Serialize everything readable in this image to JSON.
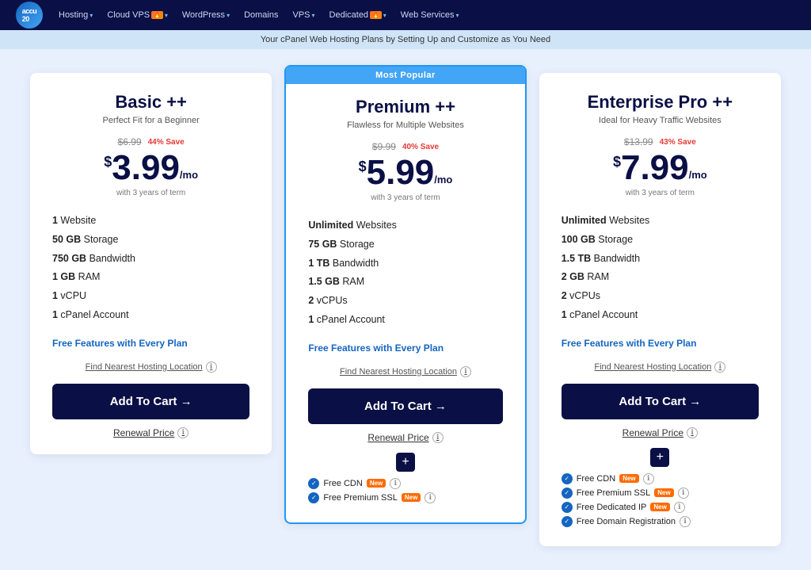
{
  "navbar": {
    "logo_text": "accu20",
    "items": [
      {
        "label": "Hosting",
        "has_chevron": true,
        "badge": null
      },
      {
        "label": "Cloud VPS",
        "has_chevron": true,
        "badge": "🔥"
      },
      {
        "label": "WordPress",
        "has_chevron": true,
        "badge": null
      },
      {
        "label": "Domains",
        "has_chevron": false,
        "badge": null
      },
      {
        "label": "VPS",
        "has_chevron": true,
        "badge": null
      },
      {
        "label": "Dedicated",
        "has_chevron": true,
        "badge": "🔥"
      },
      {
        "label": "Web Services",
        "has_chevron": true,
        "badge": null
      }
    ]
  },
  "subtitle": "Your cPanel Web Hosting Plans by Setting Up and Customize as You Need",
  "plans": [
    {
      "id": "basic",
      "name": "Basic ++",
      "tagline": "Perfect Fit for a Beginner",
      "popular": false,
      "original_price": "$6.99",
      "save_text": "44% Save",
      "price": "3.99",
      "price_term": "with 3 years of term",
      "features": [
        {
          "bold": "1",
          "text": " Website"
        },
        {
          "bold": "50 GB",
          "text": " Storage"
        },
        {
          "bold": "750 GB",
          "text": " Bandwidth"
        },
        {
          "bold": "1 GB",
          "text": " RAM"
        },
        {
          "bold": "1",
          "text": " vCPU"
        },
        {
          "bold": "1",
          "text": " cPanel Account"
        }
      ],
      "free_features_label": "Free Features with Every Plan",
      "hosting_location_label": "Find Nearest Hosting Location",
      "add_to_cart_label": "Add To Cart →",
      "renewal_label": "Renewal Price",
      "expand": false,
      "bonus_features": []
    },
    {
      "id": "premium",
      "name": "Premium ++",
      "tagline": "Flawless for Multiple Websites",
      "popular": true,
      "popular_label": "Most Popular",
      "original_price": "$9.99",
      "save_text": "40% Save",
      "price": "5.99",
      "price_term": "with 3 years of term",
      "features": [
        {
          "bold": "Unlimited",
          "text": " Websites"
        },
        {
          "bold": "75 GB",
          "text": " Storage"
        },
        {
          "bold": "1 TB",
          "text": " Bandwidth"
        },
        {
          "bold": "1.5 GB",
          "text": " RAM"
        },
        {
          "bold": "2",
          "text": " vCPUs"
        },
        {
          "bold": "1",
          "text": " cPanel Account"
        }
      ],
      "free_features_label": "Free Features with Every Plan",
      "hosting_location_label": "Find Nearest Hosting Location",
      "add_to_cart_label": "Add To Cart →",
      "renewal_label": "Renewal Price",
      "expand": true,
      "bonus_features": [
        {
          "label": "Free CDN",
          "badge": "New"
        },
        {
          "label": "Free Premium SSL",
          "badge": "New"
        }
      ]
    },
    {
      "id": "enterprise",
      "name": "Enterprise Pro ++",
      "tagline": "Ideal for Heavy Traffic Websites",
      "popular": false,
      "original_price": "$13.99",
      "save_text": "43% Save",
      "price": "7.99",
      "price_term": "with 3 years of term",
      "features": [
        {
          "bold": "Unlimited",
          "text": " Websites"
        },
        {
          "bold": "100 GB",
          "text": " Storage"
        },
        {
          "bold": "1.5 TB",
          "text": " Bandwidth"
        },
        {
          "bold": "2 GB",
          "text": " RAM"
        },
        {
          "bold": "2",
          "text": " vCPUs"
        },
        {
          "bold": "1",
          "text": " cPanel Account"
        }
      ],
      "free_features_label": "Free Features with Every Plan",
      "hosting_location_label": "Find Nearest Hosting Location",
      "add_to_cart_label": "Add To Cart →",
      "renewal_label": "Renewal Price",
      "expand": true,
      "bonus_features": [
        {
          "label": "Free CDN",
          "badge": "New"
        },
        {
          "label": "Free Premium SSL",
          "badge": "New"
        },
        {
          "label": "Free Dedicated IP",
          "badge": "New"
        },
        {
          "label": "Free Domain Registration",
          "badge": null
        }
      ]
    }
  ]
}
